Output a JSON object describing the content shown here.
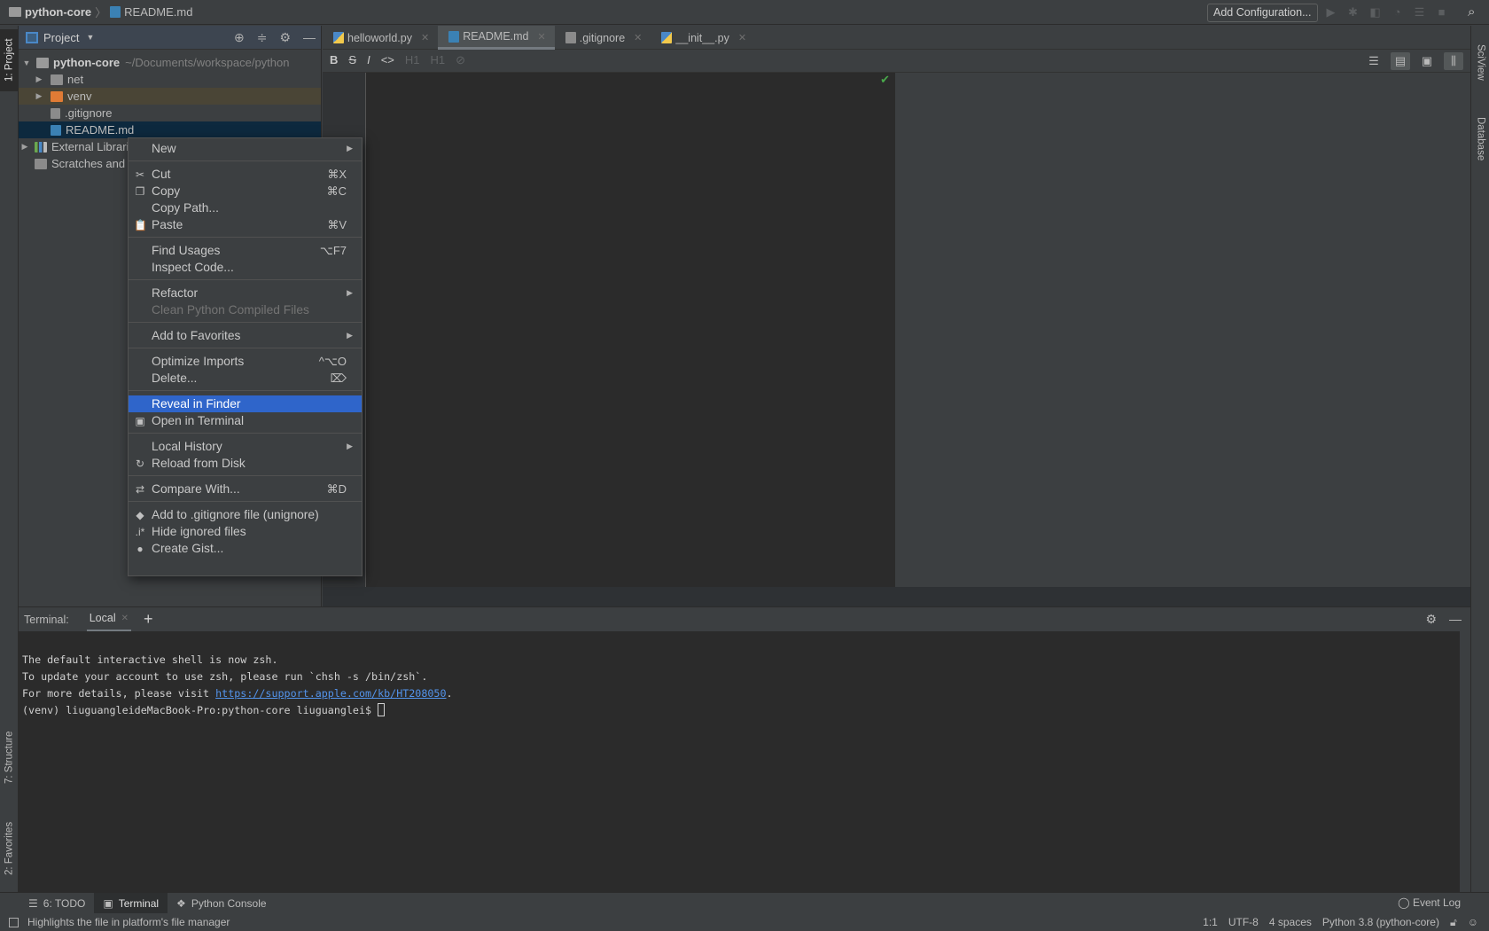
{
  "navbar": {
    "project": "python-core",
    "separator": "〉",
    "file": "README.md",
    "add_configuration": "Add Configuration...",
    "run_icons": [
      "run-icon",
      "debug-icon",
      "coverage-icon",
      "profile-icon",
      "concurrency-icon",
      "stop-icon"
    ]
  },
  "left_strip": {
    "project_tab": "1: Project",
    "structure_tab": "7: Structure",
    "favorites_tab": "2: Favorites"
  },
  "right_strip": {
    "sciview_tab": "SciView",
    "database_tab": "Database"
  },
  "project_panel": {
    "title": "Project",
    "tree": [
      {
        "label": "python-core",
        "hint": "~/Documents/workspace/python",
        "type": "root",
        "expanded": true
      },
      {
        "label": "net",
        "type": "folder",
        "expanded": false
      },
      {
        "label": "venv",
        "type": "excluded-folder",
        "expanded": false
      },
      {
        "label": ".gitignore",
        "type": "gitignore-file"
      },
      {
        "label": "README.md",
        "type": "md-file",
        "selected": true
      },
      {
        "label": "External Libraries",
        "type": "libraries",
        "expanded": false
      },
      {
        "label": "Scratches and Consoles",
        "type": "scratches"
      }
    ]
  },
  "editor_tabs": [
    {
      "label": "helloworld.py",
      "active": false
    },
    {
      "label": "README.md",
      "active": true
    },
    {
      "label": ".gitignore",
      "active": false
    },
    {
      "label": "__init__.py",
      "active": false
    }
  ],
  "md_toolbar": {
    "bold": "B",
    "strike": "S",
    "italic": "I",
    "code": "<>",
    "h1": "H1",
    "h2": "H1",
    "link": "🔗"
  },
  "context_menu": {
    "groups": [
      [
        {
          "label": "New",
          "submenu": true
        }
      ],
      [
        {
          "label": "Cut",
          "icon": "✂",
          "shortcut": "⌘X"
        },
        {
          "label": "Copy",
          "icon": "❐",
          "shortcut": "⌘C"
        },
        {
          "label": "Copy Path..."
        },
        {
          "label": "Paste",
          "icon": "📋",
          "shortcut": "⌘V"
        }
      ],
      [
        {
          "label": "Find Usages",
          "shortcut": "⌥F7"
        },
        {
          "label": "Inspect Code..."
        }
      ],
      [
        {
          "label": "Refactor",
          "submenu": true
        },
        {
          "label": "Clean Python Compiled Files",
          "disabled": true
        }
      ],
      [
        {
          "label": "Add to Favorites",
          "submenu": true
        }
      ],
      [
        {
          "label": "Optimize Imports",
          "shortcut": "^⌥O"
        },
        {
          "label": "Delete...",
          "shortcut": "⌦"
        }
      ],
      [
        {
          "label": "Reveal in Finder",
          "highlighted": true
        },
        {
          "label": "Open in Terminal",
          "icon": "▣"
        }
      ],
      [
        {
          "label": "Local History",
          "submenu": true
        },
        {
          "label": "Reload from Disk",
          "icon": "↻"
        }
      ],
      [
        {
          "label": "Compare With...",
          "icon": "⇄",
          "shortcut": "⌘D"
        }
      ],
      [
        {
          "label": "Add to .gitignore file (unignore)",
          "icon": "◆"
        },
        {
          "label": "Hide ignored files",
          "icon": ".i*"
        },
        {
          "label": "Create Gist...",
          "icon": "●"
        }
      ]
    ]
  },
  "terminal": {
    "label": "Terminal:",
    "tab": "Local",
    "lines": [
      "The default interactive shell is now zsh.",
      "To update your account to use zsh, please run `chsh -s /bin/zsh`."
    ],
    "details_prefix": "For more details, please visit ",
    "details_link": "https://support.apple.com/kb/HT208050",
    "details_suffix": ".",
    "prompt": "(venv) liuguangleideMacBook-Pro:python-core liuguanglei$ "
  },
  "bottom_tabs": [
    {
      "label": "6: TODO",
      "icon": "☰",
      "active": false
    },
    {
      "label": "Terminal",
      "icon": "▣",
      "active": true
    },
    {
      "label": "Python Console",
      "icon": "❖",
      "active": false
    }
  ],
  "event_log": "Event Log",
  "status_bar": {
    "message": "Highlights the file in platform's file manager",
    "position": "1:1",
    "encoding": "UTF-8",
    "indent": "4 spaces",
    "interpreter": "Python 3.8 (python-core)"
  }
}
